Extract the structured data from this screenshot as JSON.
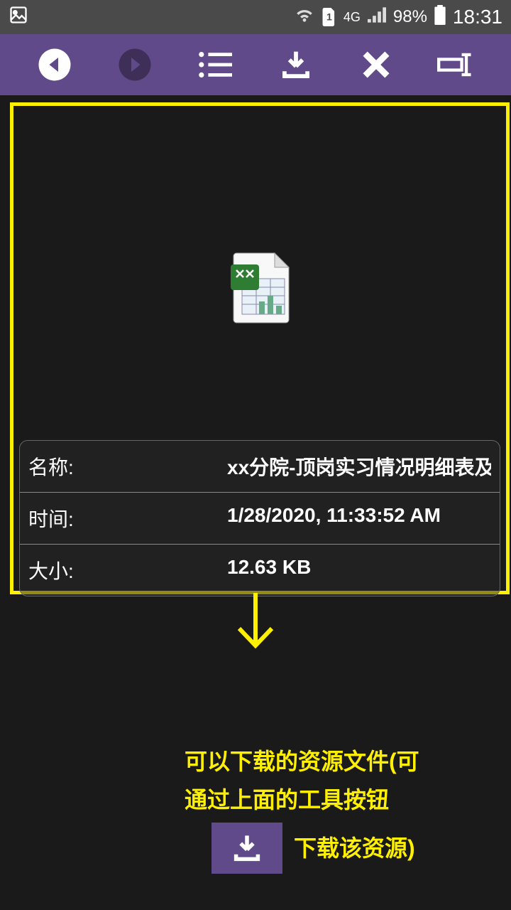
{
  "status_bar": {
    "network_label": "4G",
    "battery_percent": "98%",
    "time": "18:31"
  },
  "file_info": {
    "name_label": "名称:",
    "name_value": "xx分院-顶岗实习情况明细表及统计",
    "time_label": "时间:",
    "time_value": "1/28/2020, 11:33:52 AM",
    "size_label": "大小:",
    "size_value": "12.63 KB"
  },
  "annotation": {
    "line1": "可以下载的资源文件(可",
    "line2": "通过上面的工具按钮",
    "line3": "下载该资源)"
  }
}
